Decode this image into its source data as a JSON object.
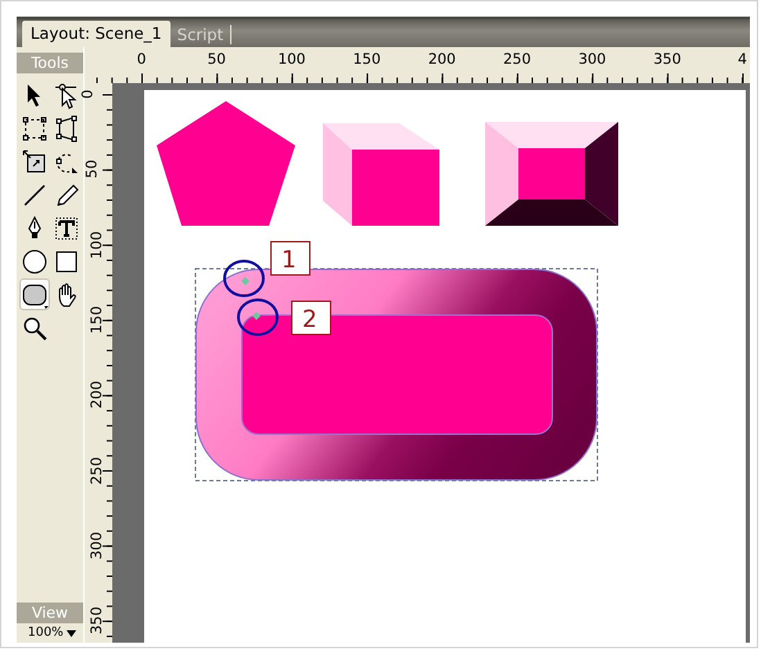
{
  "tabs": [
    {
      "label": "Layout: Scene_1",
      "selected": true
    },
    {
      "label": "Script",
      "selected": false
    }
  ],
  "tools_panel": {
    "title": "Tools",
    "tools": [
      {
        "kind": "arrow",
        "selected": false
      },
      {
        "kind": "subselect",
        "selected": false
      },
      {
        "kind": "transform",
        "selected": false
      },
      {
        "kind": "distort",
        "selected": false
      },
      {
        "kind": "scale",
        "selected": false
      },
      {
        "kind": "rotate",
        "selected": false
      },
      {
        "kind": "line",
        "selected": false
      },
      {
        "kind": "pencil",
        "selected": false
      },
      {
        "kind": "pen",
        "selected": false
      },
      {
        "kind": "text",
        "selected": false
      },
      {
        "kind": "oval",
        "selected": false
      },
      {
        "kind": "rectangle",
        "selected": false
      },
      {
        "kind": "rounded",
        "selected": true
      },
      {
        "kind": "hand",
        "selected": false
      },
      {
        "kind": "zoom",
        "selected": false
      }
    ],
    "view_title": "View",
    "zoom": "100%"
  },
  "rulers": {
    "horizontal": [
      "0",
      "50",
      "100",
      "150",
      "200",
      "250",
      "300",
      "350",
      "4"
    ],
    "vertical": [
      "0",
      "50",
      "100",
      "150",
      "200",
      "250",
      "300",
      "350"
    ]
  },
  "canvas": {
    "callouts": [
      {
        "label": "1"
      },
      {
        "label": "2"
      }
    ]
  }
}
